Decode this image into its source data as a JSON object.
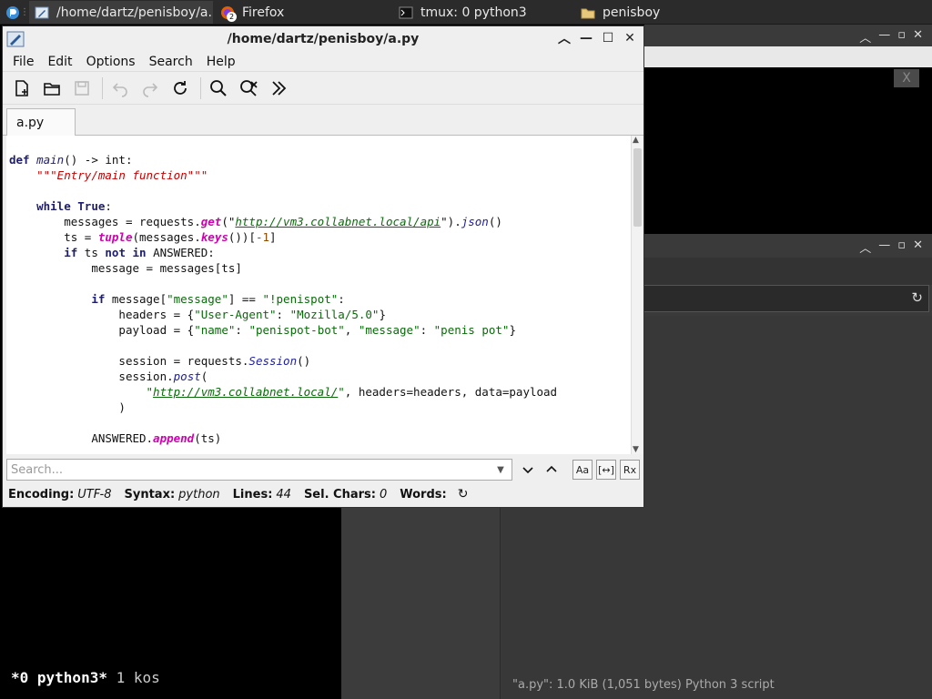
{
  "taskbar": {
    "tasks": [
      {
        "label": "/home/dartz/penisboy/a...."
      },
      {
        "label": "Firefox",
        "badge": "2"
      },
      {
        "label": "tmux: 0 python3"
      },
      {
        "label": "penisboy"
      }
    ]
  },
  "bg_terminal": {
    "close_label": "X"
  },
  "firefox": {
    "status": "\"a.py\": 1.0 KiB (1,051 bytes) Python 3 script"
  },
  "tmux": {
    "window": "*0 python3*",
    "rest": "1 kos"
  },
  "editor": {
    "title": "/home/dartz/penisboy/a.py",
    "menu": [
      "File",
      "Edit",
      "Options",
      "Search",
      "Help"
    ],
    "tab": "a.py",
    "search_placeholder": "Search...",
    "search_opts": [
      "Aa",
      "[↔]",
      "Rx"
    ],
    "status": {
      "encoding_label": "Encoding:",
      "encoding": "UTF-8",
      "syntax_label": "Syntax:",
      "syntax": "python",
      "lines_label": "Lines:",
      "lines": "44",
      "sel_label": "Sel. Chars:",
      "sel": "0",
      "words_label": "Words:"
    },
    "code": {
      "l1_kw": "def",
      "l1_fn": "main",
      "l1_rest": "() -> int:",
      "l2": "\"\"\"Entry/main function\"\"\"",
      "l4_kw1": "while",
      "l4_kw2": "True",
      "l4_rest": ":",
      "l5_a": "messages = requests.",
      "l5_call": "get",
      "l5_b": "(\"",
      "l5_url": "http://vm3.collabnet.local/api",
      "l5_c": "\").",
      "l5_call2": "json",
      "l5_d": "()",
      "l6_a": "ts = ",
      "l6_bi": "tuple",
      "l6_b": "(messages.",
      "l6_call": "keys",
      "l6_c": "())[",
      "l6_num": "-1",
      "l6_d": "]",
      "l7_kw": "if",
      "l7_a": " ts ",
      "l7_kw2": "not in",
      "l7_b": " ANSWERED:",
      "l8": "message = messages[ts]",
      "l10_kw": "if",
      "l10_a": " message[",
      "l10_s1": "\"message\"",
      "l10_b": "] == ",
      "l10_s2": "\"!penispot\"",
      "l10_c": ":",
      "l11_a": "headers = {",
      "l11_s1": "\"User-Agent\"",
      "l11_b": ": ",
      "l11_s2": "\"Mozilla/5.0\"",
      "l11_c": "}",
      "l12_a": "payload = {",
      "l12_s1": "\"name\"",
      "l12_b": ": ",
      "l12_s2": "\"penispot-bot\"",
      "l12_c": ", ",
      "l12_s3": "\"message\"",
      "l12_d": ": ",
      "l12_s4": "\"penis pot\"",
      "l12_e": "}",
      "l14_a": "session = requests.",
      "l14_call": "Session",
      "l14_b": "()",
      "l15_a": "session.",
      "l15_call": "post",
      "l15_b": "(",
      "l16_q1": "\"",
      "l16_url": "http://vm3.collabnet.local/",
      "l16_q2": "\"",
      "l16_rest": ", headers=headers, data=payload",
      "l17": ")",
      "l19_a": "ANSWERED.",
      "l19_bi": "append",
      "l19_b": "(ts)"
    }
  }
}
